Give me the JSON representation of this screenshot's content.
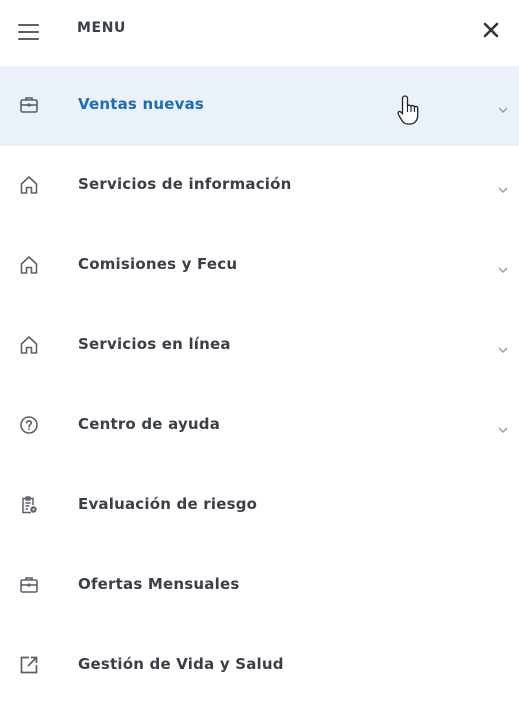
{
  "header": {
    "title": "MENU",
    "menu_icon": "hamburger-icon",
    "close_icon": "close-icon"
  },
  "menu": {
    "items": [
      {
        "label": "Ventas nuevas",
        "icon": "briefcase-icon",
        "expandable": true,
        "active": true
      },
      {
        "label": "Servicios de información",
        "icon": "home-icon",
        "expandable": true
      },
      {
        "label": "Comisiones y Fecu",
        "icon": "home-icon",
        "expandable": true
      },
      {
        "label": "Servicios en línea",
        "icon": "home-icon",
        "expandable": true
      },
      {
        "label": "Centro de ayuda",
        "icon": "help-circle-icon",
        "expandable": true
      },
      {
        "label": "Evaluación de riesgo",
        "icon": "clipboard-icon",
        "expandable": false
      },
      {
        "label": "Ofertas Mensuales",
        "icon": "briefcase-icon",
        "expandable": false
      },
      {
        "label": "Gestión de Vida y Salud",
        "icon": "external-link-icon",
        "expandable": false
      }
    ]
  },
  "colors": {
    "active_bg": "#eaf1f8",
    "active_text": "#1f6cb3",
    "text": "#3b4048",
    "icon": "#5b6169",
    "chevron": "#9aa0a6"
  }
}
